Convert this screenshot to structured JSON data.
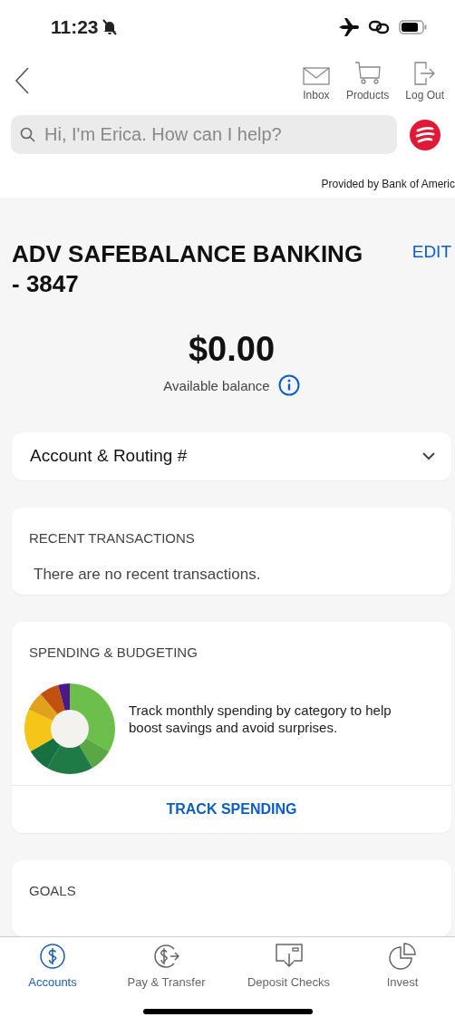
{
  "status_bar": {
    "time": "11:23"
  },
  "header": {
    "actions": [
      {
        "label": "Inbox",
        "kind": "mail"
      },
      {
        "label": "Products",
        "kind": "cart"
      },
      {
        "label": "Log Out",
        "kind": "logout"
      }
    ]
  },
  "search": {
    "placeholder": "Hi, I'm Erica. How can I help?"
  },
  "provider_note": "Provided by Bank of Americ",
  "account": {
    "title": "ADV SAFEBALANCE BANKING - 3847",
    "edit": "EDIT",
    "balance": "$0.00",
    "balance_label": "Available balance"
  },
  "routing": {
    "label": "Account & Routing #",
    "expanded": false
  },
  "recent": {
    "heading": "RECENT TRANSACTIONS",
    "empty": "There are no recent transactions."
  },
  "spending": {
    "heading": "SPENDING & BUDGETING",
    "text": "Track monthly spending by category to help boost savings and avoid surprises.",
    "action": "TRACK SPENDING"
  },
  "goals": {
    "heading": "GOALS"
  },
  "tabs": [
    {
      "label": "Accounts",
      "kind": "dollar",
      "selected": true
    },
    {
      "label": "Pay & Transfer",
      "kind": "transfer",
      "selected": false
    },
    {
      "label": "Deposit Checks",
      "kind": "check",
      "selected": false
    },
    {
      "label": "Invest",
      "kind": "pie",
      "selected": false
    }
  ]
}
